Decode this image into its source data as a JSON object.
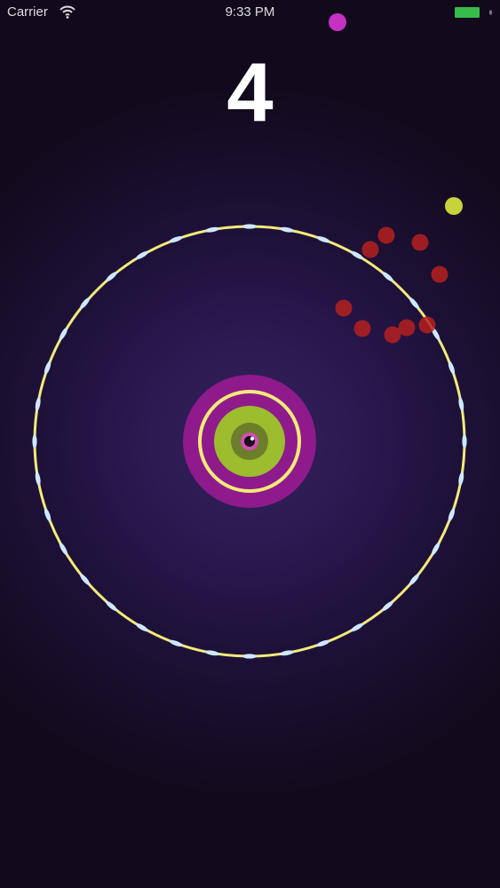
{
  "status_bar": {
    "carrier": "Carrier",
    "time": "9:33 PM",
    "wifi_icon": "wifi-icon",
    "battery_icon": "battery-icon",
    "battery_color": "#3ddc53"
  },
  "game": {
    "score": "4",
    "colors": {
      "ring": "#f3ea7a",
      "spike": "#cfe8ff",
      "core_outer": "#8f1a8c",
      "core_ring": "#f3ea7a",
      "core_inner": "#9bbd2e",
      "core_center": "#6c7d2c",
      "core_eye": "#cf4fb4",
      "ball_pink": "#c631c4",
      "ball_lime": "#c8d23c",
      "particles": "#b5201e"
    },
    "spike_count": 36
  }
}
